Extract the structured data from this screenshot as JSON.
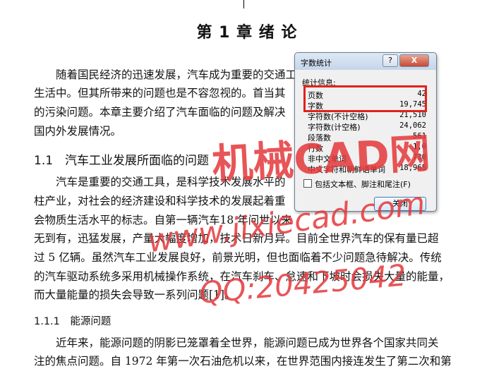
{
  "document": {
    "chapter_title": "第 1 章  绪  论",
    "paragraphs": [
      "　　随着国民经济的迅速发展，汽车成为重要的交通工具",
      "生活中。但其所带来的问题也是不容忽视的。首当其",
      "的污染问题。本章主要介绍了汽车面临的问题及解决",
      "国内外发展情况。"
    ],
    "section_1_1": "1.1　汽车工业发展所面临的问题",
    "section_1_1_lines": [
      "　　汽车是重要的交通工具，是科学技术发展水平的",
      "柱产业，对社会的经济建设和科学技术的发展起着重",
      "会物质生活水平的标志。自第一辆汽车18  年问世以来",
      "无到有，迅猛发展，产量大幅度增加，技术日新月异。目前全世界汽车的保有量已超",
      "过 5 亿辆。虽然汽车工业发展良好，前景光明，但也面临着不少问题急待解决。传统",
      "的汽车驱动系统多采用机械操作系统，在汽车刹车、怠速和下坡时会损失大量的能量，",
      "而大量能量的损失会导致一系列问题[1]。"
    ],
    "section_1_1_1": "1.1.1　能源问题",
    "section_1_1_1_lines": [
      "　　近年来，能源问题的阴影已笼罩着全世界，能源问题已成为世界各个国家共同关",
      "注的焦点问题。自 1972 年第一次石油危机以来，在世界范围内接连发生了第二次和第"
    ]
  },
  "dialog": {
    "title": "字数统计",
    "help_label": "?",
    "close_label": "X",
    "group_label": "统计信息:",
    "stats": [
      {
        "key": "页数",
        "value": "42"
      },
      {
        "key": "字数",
        "value": "19,745"
      },
      {
        "key": "字符数(不计空格)",
        "value": "21,510"
      },
      {
        "key": "字符数(计空格)",
        "value": "24,062"
      },
      {
        "key": "段落数",
        "value": "561"
      },
      {
        "key": "行数",
        "value": "1,0"
      },
      {
        "key": "非中文单词",
        "value": "730"
      },
      {
        "key": "中文字符和朝鲜语单词",
        "value": "18,965"
      }
    ],
    "checkbox_label": "包括文本框、脚注和尾注(F)",
    "ok_label": "关闭"
  },
  "watermark": {
    "line1": "机械CAD网",
    "line2": "www.jixiecad.com",
    "line3": "QQ:20425042"
  },
  "colors": {
    "highlight": "#e0221b",
    "watermark": "#e5383b"
  }
}
